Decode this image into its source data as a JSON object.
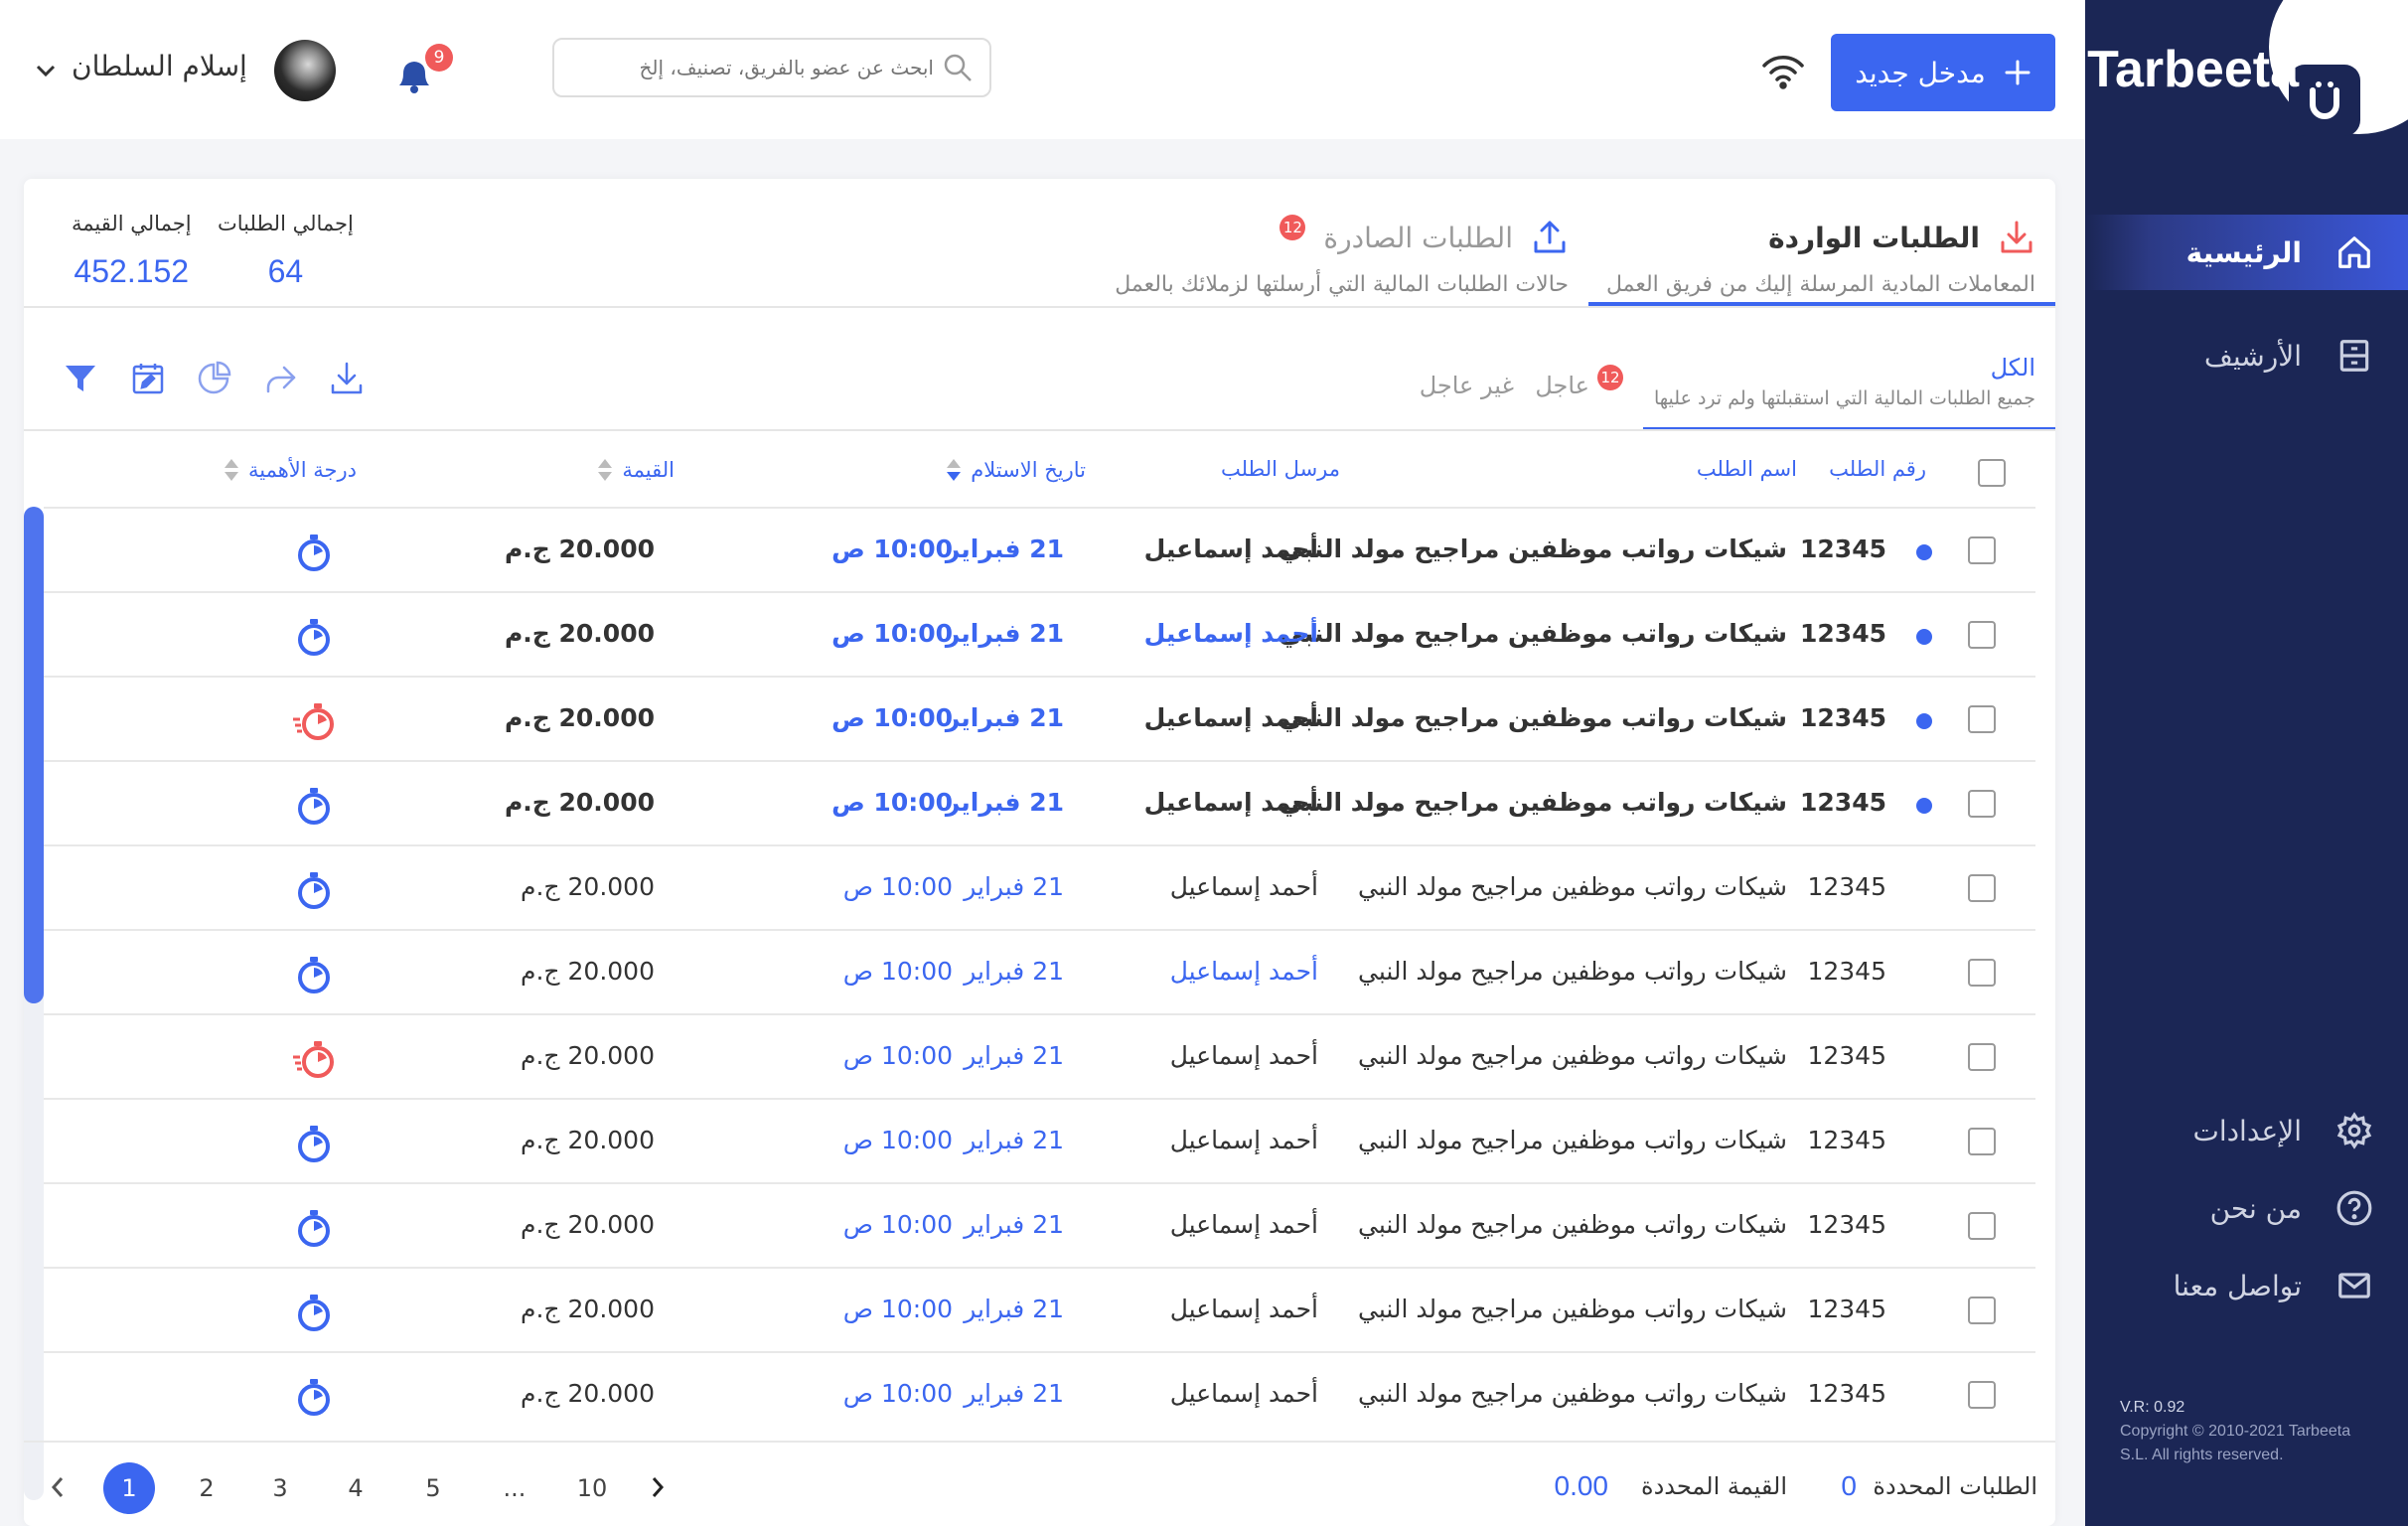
{
  "app": {
    "brand": "Tarbeeta",
    "version": "V.R: 0.92",
    "copyright": "Copyright © 2010-2021 Tarbeeta S.L. All rights reserved."
  },
  "sidebar": {
    "items": [
      {
        "label": "الرئيسية",
        "icon": "home-icon",
        "active": true
      },
      {
        "label": "الأرشيف",
        "icon": "archive-icon",
        "active": false
      }
    ],
    "bottom_items": [
      {
        "label": "الإعدادات",
        "icon": "gear-icon"
      },
      {
        "label": "من نحن",
        "icon": "help-circle-icon"
      },
      {
        "label": "تواصل معنا",
        "icon": "mail-icon"
      }
    ]
  },
  "header": {
    "new_button": "مدخل جديد",
    "search_placeholder": "ابحث عن عضو بالفريق، تصنيف، إلخ",
    "notifications_count": "9",
    "user_name": "إسلام السلطان"
  },
  "tabs": {
    "incoming": {
      "title": "الطلبات الواردة",
      "subtitle": "المعاملات المادية المرسلة إليك من فريق العمل"
    },
    "outgoing": {
      "title": "الطلبات الصادرة",
      "subtitle": "حالات الطلبات المالية التي أرسلتها لزملائك بالعمل",
      "badge": "12"
    }
  },
  "stats": {
    "total_requests_label": "إجمالي الطلبات",
    "total_requests_value": "64",
    "total_value_label": "إجمالي القيمة",
    "total_value_value": "452.152"
  },
  "subtabs": {
    "all": {
      "title": "الكل",
      "subtitle": "جميع الطلبات المالية التي استقبلتها ولم ترد عليها"
    },
    "urgent": {
      "title": "عاجل",
      "badge": "12"
    },
    "non_urgent": {
      "title": "غير عاجل"
    }
  },
  "table": {
    "headers": {
      "number": "رقم الطلب",
      "name": "اسم الطلب",
      "sender": "مرسل الطلب",
      "date": "تاريخ الاستلام",
      "value": "القيمة",
      "priority": "درجة الأهمية"
    },
    "rows": [
      {
        "number": "12345",
        "name": "شيكات رواتب موظفين مراجيح مولد النبي",
        "sender": "أحمد إسماعيل",
        "date": "21 فبراير",
        "time": "10:00 ص",
        "value": "20.000 ج.م",
        "unread": true,
        "sender_link": false,
        "urgent": false
      },
      {
        "number": "12345",
        "name": "شيكات رواتب موظفين مراجيح مولد النبي",
        "sender": "أحمد إسماعيل",
        "date": "21 فبراير",
        "time": "10:00 ص",
        "value": "20.000 ج.م",
        "unread": true,
        "sender_link": true,
        "urgent": false
      },
      {
        "number": "12345",
        "name": "شيكات رواتب موظفين مراجيح مولد النبي",
        "sender": "أحمد إسماعيل",
        "date": "21 فبراير",
        "time": "10:00 ص",
        "value": "20.000 ج.م",
        "unread": true,
        "sender_link": false,
        "urgent": true
      },
      {
        "number": "12345",
        "name": "شيكات رواتب موظفين مراجيح مولد النبي",
        "sender": "أحمد إسماعيل",
        "date": "21 فبراير",
        "time": "10:00 ص",
        "value": "20.000 ج.م",
        "unread": true,
        "sender_link": false,
        "urgent": false
      },
      {
        "number": "12345",
        "name": "شيكات رواتب موظفين مراجيح مولد النبي",
        "sender": "أحمد إسماعيل",
        "date": "21 فبراير",
        "time": "10:00 ص",
        "value": "20.000 ج.م",
        "unread": false,
        "sender_link": false,
        "urgent": false
      },
      {
        "number": "12345",
        "name": "شيكات رواتب موظفين مراجيح مولد النبي",
        "sender": "أحمد إسماعيل",
        "date": "21 فبراير",
        "time": "10:00 ص",
        "value": "20.000 ج.م",
        "unread": false,
        "sender_link": true,
        "urgent": false
      },
      {
        "number": "12345",
        "name": "شيكات رواتب موظفين مراجيح مولد النبي",
        "sender": "أحمد إسماعيل",
        "date": "21 فبراير",
        "time": "10:00 ص",
        "value": "20.000 ج.م",
        "unread": false,
        "sender_link": false,
        "urgent": true
      },
      {
        "number": "12345",
        "name": "شيكات رواتب موظفين مراجيح مولد النبي",
        "sender": "أحمد إسماعيل",
        "date": "21 فبراير",
        "time": "10:00 ص",
        "value": "20.000 ج.م",
        "unread": false,
        "sender_link": false,
        "urgent": false
      },
      {
        "number": "12345",
        "name": "شيكات رواتب موظفين مراجيح مولد النبي",
        "sender": "أحمد إسماعيل",
        "date": "21 فبراير",
        "time": "10:00 ص",
        "value": "20.000 ج.م",
        "unread": false,
        "sender_link": false,
        "urgent": false
      },
      {
        "number": "12345",
        "name": "شيكات رواتب موظفين مراجيح مولد النبي",
        "sender": "أحمد إسماعيل",
        "date": "21 فبراير",
        "time": "10:00 ص",
        "value": "20.000 ج.م",
        "unread": false,
        "sender_link": false,
        "urgent": false
      },
      {
        "number": "12345",
        "name": "شيكات رواتب موظفين مراجيح مولد النبي",
        "sender": "أحمد إسماعيل",
        "date": "21 فبراير",
        "time": "10:00 ص",
        "value": "20.000 ج.م",
        "unread": false,
        "sender_link": false,
        "urgent": false
      }
    ]
  },
  "footer": {
    "selected_requests_label": "الطلبات المحددة",
    "selected_requests_value": "0",
    "selected_value_label": "القيمة المحددة",
    "selected_value_value": "0.00",
    "pages": [
      "1",
      "2",
      "3",
      "4",
      "5",
      "...",
      "10"
    ],
    "current_page": "1"
  },
  "colors": {
    "primary": "#3b66f0",
    "sidebar": "#1b2655",
    "urgent": "#f05a5a"
  }
}
